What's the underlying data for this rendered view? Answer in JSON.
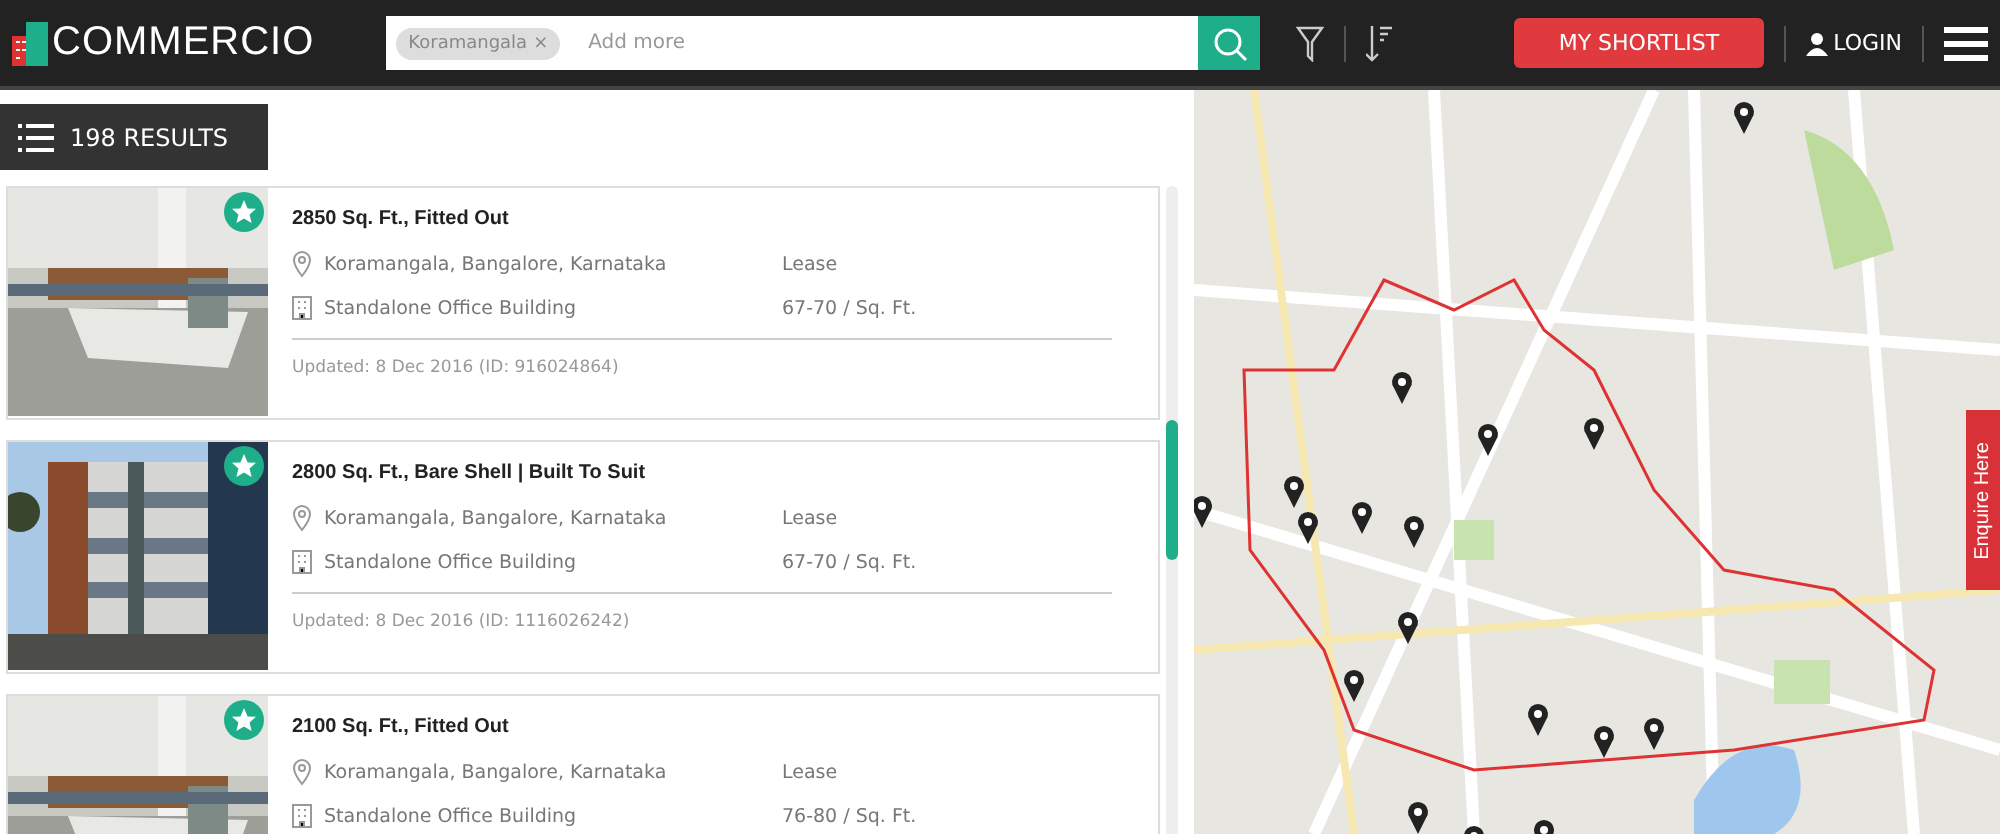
{
  "header": {
    "logo": "COMMERCIO",
    "search": {
      "tags": [
        {
          "label": "Koramangala",
          "remove": "×"
        }
      ],
      "placeholder": "Add more"
    },
    "shortlist": "MY SHORTLIST",
    "login": "LOGIN"
  },
  "results": {
    "count": "198 RESULTS"
  },
  "listings": [
    {
      "title": "2850 Sq. Ft., Fitted Out",
      "location": "Koramangala, Bangalore, Karnataka",
      "deal": "Lease",
      "type": "Standalone Office Building",
      "price": "67-70 / Sq. Ft.",
      "updated": "Updated: 8 Dec 2016 (ID: 916024864)"
    },
    {
      "title": "2800 Sq. Ft., Bare Shell | Built To Suit",
      "location": "Koramangala, Bangalore, Karnataka",
      "deal": "Lease",
      "type": "Standalone Office Building",
      "price": "67-70 / Sq. Ft.",
      "updated": "Updated: 8 Dec 2016 (ID: 1116026242)"
    },
    {
      "title": "2100 Sq. Ft., Fitted Out",
      "location": "Koramangala, Bangalore, Karnataka",
      "deal": "Lease",
      "type": "Standalone Office Building",
      "price": "76-80 / Sq. Ft."
    }
  ],
  "map": {
    "kind": "picture",
    "enquire": "Enquire Here"
  }
}
